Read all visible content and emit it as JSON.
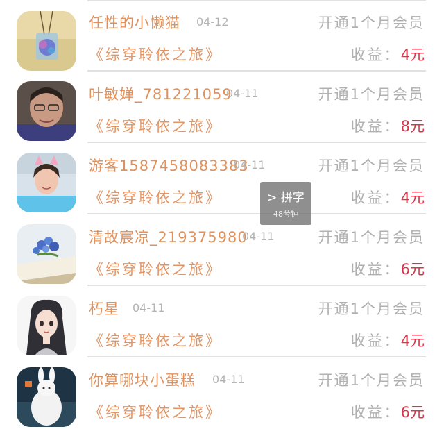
{
  "entries": [
    {
      "name": "任性的小懒猫",
      "date": "04-12",
      "action": "开通1个月会员",
      "book": "《综穿聆依之旅》",
      "income_label": "收益：",
      "income_value": "4元",
      "avatar": "pendant-photo"
    },
    {
      "name": "叶敏婵_781221059",
      "date": "04-11",
      "action": "开通1个月会员",
      "book": "《综穿聆依之旅》",
      "income_label": "收益：",
      "income_value": "8元",
      "avatar": "woman-photo"
    },
    {
      "name": "游客1587458083383",
      "date": "04-11",
      "action": "开通1个月会员",
      "book": "《综穿聆依之旅》",
      "income_label": "收益：",
      "income_value": "4元",
      "avatar": "child-photo"
    },
    {
      "name": "清故宸凉_219375980",
      "date": "04-11",
      "action": "开通1个月会员",
      "book": "《综穿聆依之旅》",
      "income_label": "收益：",
      "income_value": "6元",
      "avatar": "flowers-photo"
    },
    {
      "name": "朽星",
      "date": "04-11",
      "action": "开通1个月会员",
      "book": "《综穿聆依之旅》",
      "income_label": "收益：",
      "income_value": "4元",
      "avatar": "anime-girl-illustration"
    },
    {
      "name": "你算哪块小蛋糕",
      "date": "04-11",
      "action": "开通1个月会员",
      "book": "《综穿聆依之旅》",
      "income_label": "收益：",
      "income_value": "6元",
      "avatar": "rabbit-photo"
    }
  ],
  "overlay": {
    "title": "> 拼字",
    "subtitle": "48兮钟"
  },
  "colors": {
    "name": "#e0925e",
    "book": "#e39463",
    "income_value": "#d9344a",
    "muted": "#b0b0b0"
  }
}
